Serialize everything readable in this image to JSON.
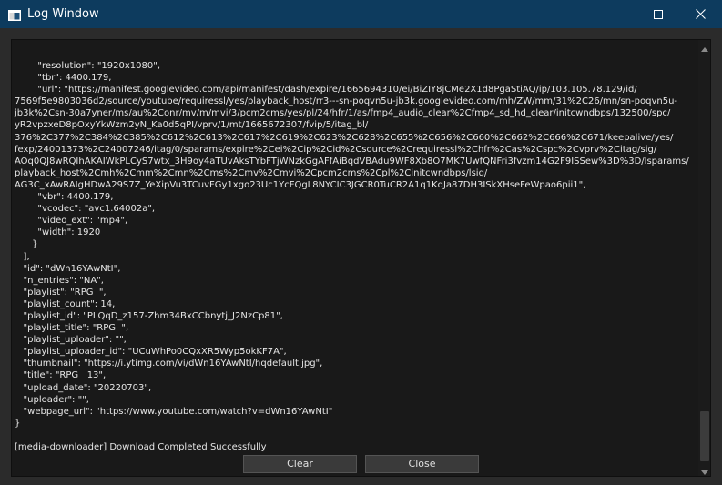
{
  "window": {
    "title": "Log Window",
    "icons": {
      "app": "window-icon",
      "minimize": "minimize-icon",
      "maximize": "maximize-icon",
      "close": "close-icon"
    }
  },
  "log": {
    "lines": [
      "        \"resolution\": \"1920x1080\",",
      "        \"tbr\": 4400.179,",
      "        \"url\": \"https://manifest.googlevideo.com/api/manifest/dash/expire/1665694310/ei/BiZIY8jCMe2X1d8PgaStiAQ/ip/103.105.78.129/id/",
      "7569f5e9803036d2/source/youtube/requiressl/yes/playback_host/rr3---sn-poqvn5u-jb3k.googlevideo.com/mh/ZW/mm/31%2C26/mn/sn-poqvn5u-",
      "jb3k%2Csn-30a7yner/ms/au%2Conr/mv/m/mvi/3/pcm2cms/yes/pl/24/hfr/1/as/fmp4_audio_clear%2Cfmp4_sd_hd_clear/initcwndbps/132500/spc/",
      "yR2vpzxeD8pOxyYkWzm2yN_Ka0d5qPI/vprv/1/mt/1665672307/fvip/5/itag_bl/",
      "376%2C377%2C384%2C385%2C612%2C613%2C617%2C619%2C623%2C628%2C655%2C656%2C660%2C662%2C666%2C671/keepalive/yes/",
      "fexp/24001373%2C24007246/itag/0/sparams/expire%2Cei%2Cip%2Cid%2Csource%2Crequiressl%2Chfr%2Cas%2Cspc%2Cvprv%2Citag/sig/",
      "AOq0QJ8wRQIhAKAIWkPLCyS7wtx_3H9oy4aTUvAksTYbFTjWNzkGgAFfAiBqdVBAdu9WF8Xb8O7MK7UwfQNFri3fvzm14G2F9ISSew%3D%3D/lsparams/",
      "playback_host%2Cmh%2Cmm%2Cmn%2Cms%2Cmv%2Cmvi%2Cpcm2cms%2Cpl%2Cinitcwndbps/lsig/",
      "AG3C_xAwRAIgHDwA29S7Z_YeXipVu3TCuvFGy1xgo23Uc1YcFQgL8NYCIC3JGCR0TuCR2A1q1KqJa87DH3ISkXHseFeWpao6pii1\",",
      "        \"vbr\": 4400.179,",
      "        \"vcodec\": \"avc1.64002a\",",
      "        \"video_ext\": \"mp4\",",
      "        \"width\": 1920",
      "      }",
      "   ],",
      "   \"id\": \"dWn16YAwNtI\",",
      "   \"n_entries\": \"NA\",",
      "   \"playlist\": \"RPG  \",",
      "   \"playlist_count\": 14,",
      "   \"playlist_id\": \"PLQqD_z157-Zhm34BxCCbnytj_J2NzCp81\",",
      "   \"playlist_title\": \"RPG  \",",
      "   \"playlist_uploader\": \"\",",
      "   \"playlist_uploader_id\": \"UCuWhPo0CQxXR5Wyp5okKF7A\",",
      "   \"thumbnail\": \"https://i.ytimg.com/vi/dWn16YAwNtI/hqdefault.jpg\",",
      "   \"title\": \"RPG   13\",",
      "   \"upload_date\": \"20220703\",",
      "   \"uploader\": \"\",",
      "   \"webpage_url\": \"https://www.youtube.com/watch?v=dWn16YAwNtI\"",
      "}",
      "",
      "[media-downloader] Download Completed Successfully"
    ]
  },
  "scrollbar": {
    "up_icon": "scroll-up-arrow-icon",
    "down_icon": "scroll-down-arrow-icon",
    "position": 1.0
  },
  "buttons": {
    "clear": "Clear",
    "close": "Close"
  }
}
